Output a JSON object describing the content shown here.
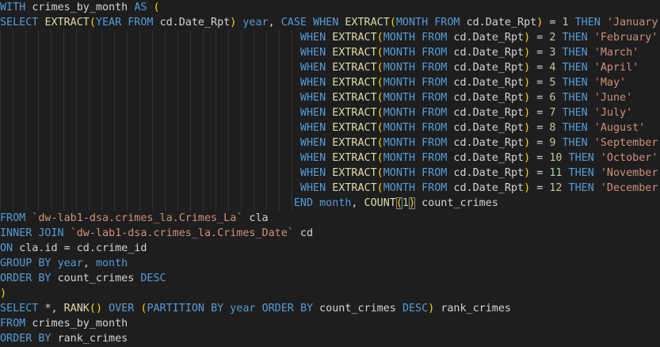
{
  "editor": {
    "language": "SQL",
    "colors": {
      "background": "#1e1e1e",
      "keyword": "#569cd6",
      "function": "#dcdcaa",
      "identifier": "#9cdcfe",
      "text": "#d4d4d4",
      "string": "#ce9178",
      "number": "#b5cea8",
      "bracket": "#ffd700"
    },
    "lines": [
      "WITH crimes_by_month AS (",
      "SELECT EXTRACT(YEAR FROM cd.Date_Rpt) year, CASE WHEN EXTRACT(MONTH FROM cd.Date_Rpt) = 1 THEN 'January'",
      "                                               WHEN EXTRACT(MONTH FROM cd.Date_Rpt) = 2 THEN 'February'",
      "                                               WHEN EXTRACT(MONTH FROM cd.Date_Rpt) = 3 THEN 'March'",
      "                                               WHEN EXTRACT(MONTH FROM cd.Date_Rpt) = 4 THEN 'April'",
      "                                               WHEN EXTRACT(MONTH FROM cd.Date_Rpt) = 5 THEN 'May'",
      "                                               WHEN EXTRACT(MONTH FROM cd.Date_Rpt) = 6 THEN 'June'",
      "                                               WHEN EXTRACT(MONTH FROM cd.Date_Rpt) = 7 THEN 'July'",
      "                                               WHEN EXTRACT(MONTH FROM cd.Date_Rpt) = 8 THEN 'August'",
      "                                               WHEN EXTRACT(MONTH FROM cd.Date_Rpt) = 9 THEN 'September'",
      "                                               WHEN EXTRACT(MONTH FROM cd.Date_Rpt) = 10 THEN 'October'",
      "                                               WHEN EXTRACT(MONTH FROM cd.Date_Rpt) = 11 THEN 'November'",
      "                                               WHEN EXTRACT(MONTH FROM cd.Date_Rpt) = 12 THEN 'December'",
      "                                              END month, COUNT(1) count_crimes",
      "FROM `dw-lab1-dsa.crimes_la.Crimes_La` cla",
      "INNER JOIN `dw-lab1-dsa.crimes_la.Crimes_Date` cd",
      "ON cla.id = cd.crime_id",
      "GROUP BY year, month",
      "ORDER BY count_crimes DESC",
      ")",
      "SELECT *, RANK() OVER (PARTITION BY year ORDER BY count_crimes DESC) rank_crimes",
      "FROM crimes_by_month",
      "ORDER BY rank_crimes"
    ]
  }
}
